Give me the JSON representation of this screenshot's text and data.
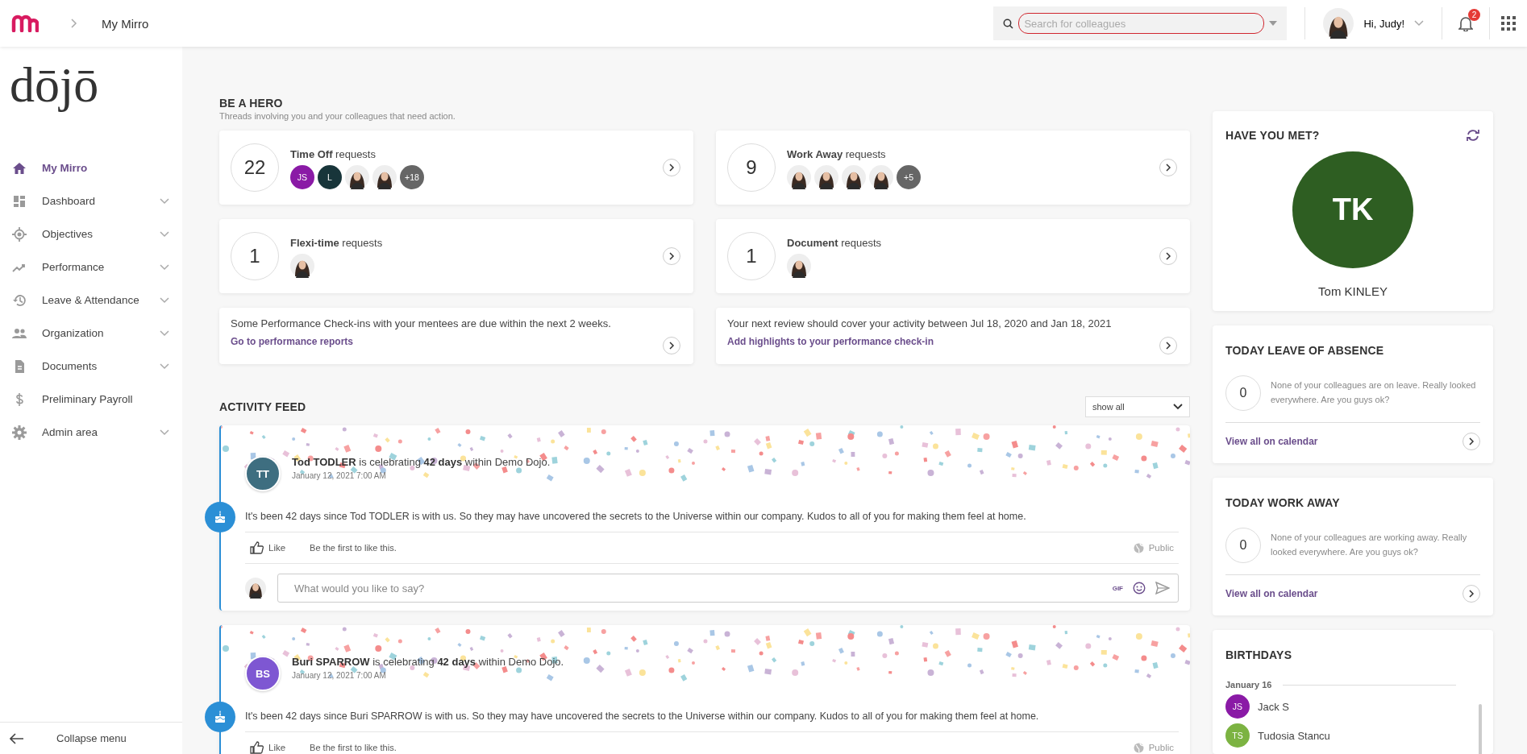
{
  "topbar": {
    "breadcrumb": "My Mirro",
    "search": {
      "placeholder": "Search for colleagues"
    },
    "greeting": "Hi, Judy!",
    "notifications": "2"
  },
  "sidebar": {
    "logo": "dōjō",
    "items": [
      {
        "label": "My Mirro",
        "selected": true,
        "expandable": false
      },
      {
        "label": "Dashboard",
        "selected": false,
        "expandable": true
      },
      {
        "label": "Objectives",
        "selected": false,
        "expandable": true
      },
      {
        "label": "Performance",
        "selected": false,
        "expandable": true
      },
      {
        "label": "Leave & Attendance",
        "selected": false,
        "expandable": true
      },
      {
        "label": "Organization",
        "selected": false,
        "expandable": true
      },
      {
        "label": "Documents",
        "selected": false,
        "expandable": true
      },
      {
        "label": "Preliminary Payroll",
        "selected": false,
        "expandable": false
      },
      {
        "label": "Admin area",
        "selected": false,
        "expandable": true
      }
    ],
    "collapse": "Collapse menu"
  },
  "hero": {
    "title": "BE A HERO",
    "subtitle": "Threads involving you and your colleagues that need action.",
    "requests": [
      {
        "count": "22",
        "label": "**Time Off** requests",
        "avatars": [
          {
            "kind": "initials",
            "initials": "JS",
            "color": "#8a1aa6"
          },
          {
            "kind": "initials",
            "initials": "L",
            "color": "#18353a"
          },
          {
            "kind": "photo"
          },
          {
            "kind": "photo"
          },
          {
            "kind": "more",
            "text": "+18"
          }
        ]
      },
      {
        "count": "9",
        "label": "**Work Away** requests",
        "avatars": [
          {
            "kind": "photo"
          },
          {
            "kind": "photo"
          },
          {
            "kind": "photo"
          },
          {
            "kind": "photo"
          },
          {
            "kind": "more",
            "text": "+5"
          }
        ]
      },
      {
        "count": "1",
        "label": "**Flexi-time** requests",
        "avatars": [
          {
            "kind": "photo"
          }
        ]
      },
      {
        "count": "1",
        "label": "**Document** requests",
        "avatars": [
          {
            "kind": "photo"
          }
        ]
      }
    ],
    "notices": [
      {
        "text": "Some Performance Check-ins with your mentees are due within the next 2 weeks.",
        "link": "Go to performance reports"
      },
      {
        "text": "Your next review should cover your activity between Jul 18, 2020 and Jan 18, 2021",
        "link": "Add highlights to your performance check-in"
      }
    ]
  },
  "feed": {
    "title": "ACTIVITY FEED",
    "filter": "show all",
    "posts": [
      {
        "initials": "TT",
        "color": "#3e6e80",
        "headline": "**Tod TODLER** is celebrating **42 days** within Demo Dojo.",
        "date": "January 12, 2021 7:00 AM",
        "body": "It's been 42 days since Tod TODLER is with us. So they may have uncovered the secrets to the Universe within our company. Kudos to all of you for making them feel at home.",
        "like": "Like",
        "like_hint": "Be the first to like this.",
        "visibility": "Public",
        "comment": {
          "placeholder": "What would you like to say?",
          "gif": "GIF"
        }
      },
      {
        "initials": "BS",
        "color": "#7e57d2",
        "headline": "**Buri SPARROW** is celebrating **42 days** within Demo Dojo.",
        "date": "January 12, 2021 7:00 AM",
        "body": "It's been 42 days since Buri SPARROW is with us. So they may have uncovered the secrets to the Universe within our company. Kudos to all of you for making them feel at home.",
        "like": "Like",
        "like_hint": "Be the first to like this.",
        "visibility": "Public"
      }
    ]
  },
  "have_you_met": {
    "title": "HAVE YOU MET?",
    "initials": "TK",
    "color": "#2e5e22",
    "name": "Tom KINLEY"
  },
  "today": [
    {
      "title": "TODAY LEAVE OF ABSENCE",
      "count": "0",
      "message": "None of your colleagues are on leave. Really looked everywhere. Are you guys ok?",
      "link": "View all on calendar"
    },
    {
      "title": "TODAY WORK AWAY",
      "count": "0",
      "message": "None of your colleagues are working away. Really looked everywhere. Are you guys ok?",
      "link": "View all on calendar"
    }
  ],
  "birthdays": {
    "title": "BIRTHDAYS",
    "groups": [
      {
        "date": "January 16",
        "people": [
          {
            "initials": "JS",
            "color": "#8a1aa6",
            "name": "Jack S"
          },
          {
            "initials": "TS",
            "color": "#7cb342",
            "name": "Tudosia Stancu"
          }
        ]
      }
    ]
  }
}
